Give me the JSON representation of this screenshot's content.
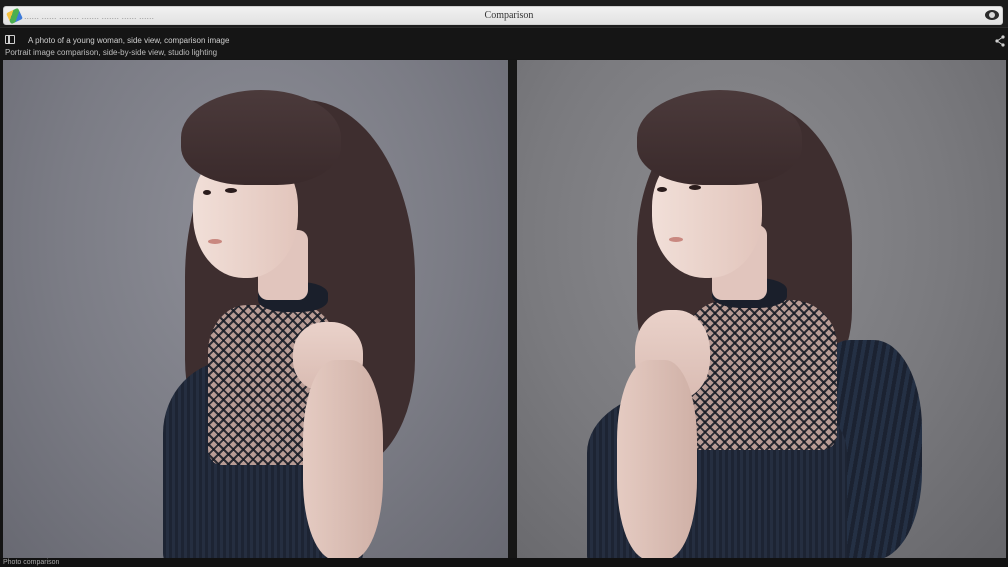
{
  "window": {
    "title": "Comparison",
    "url": "...... ...... ........ ....... ....... ...... ......"
  },
  "info": {
    "line1": "A photo of a young woman, side view, comparison image",
    "line2": "Portrait image comparison, side-by-side view, studio lighting"
  },
  "status": {
    "text": "Photo comparison"
  },
  "icons": {
    "app": "app-icon",
    "visibility": "eye-icon",
    "panel_toggle": "panel-icon",
    "share": "share-icon"
  },
  "colors": {
    "background": "#141414",
    "panel_left_bg": "#7b7c85",
    "panel_right_bg": "#7a7a7e"
  }
}
